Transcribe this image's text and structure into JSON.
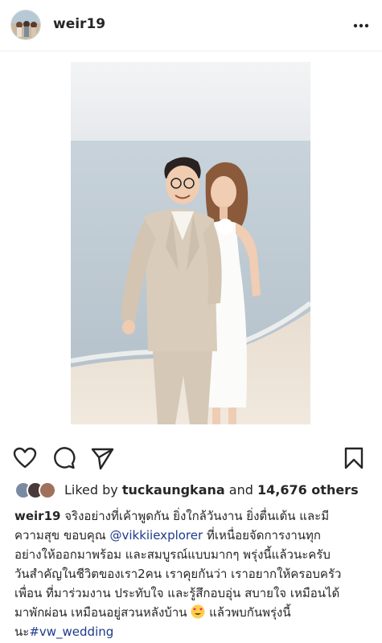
{
  "post": {
    "username": "weir19"
  },
  "likes": {
    "prefix": "Liked by",
    "liker": "tuckaungkana",
    "joiner": "and",
    "count_text": "14,676 others"
  },
  "caption": {
    "username": "weir19",
    "line1": "จริงอย่างที่เค้าพูดกัน ยิ่งใกล้วันงาน ยิ่งตื่นเต้น และมี",
    "line2_pre": "ความสุข ขอบคุณ",
    "mention": "@vikkiiexplorer",
    "line2_post": "ที่เหนื่อยจัดการงานทุก",
    "line3": "อย่างให้ออกมาพร้อม และสมบูรณ์แบบมากๆ พรุ่งนี้แล้วนะครับ",
    "line4": "วันสำคัญในชีวิตของเรา2คน เราคุยกันว่า เราอยากให้ครอบครัว",
    "line5": "เพื่อน ที่มาร่วมงาน ประทับใจ และรู้สึกอบอุ่น สบายใจ เหมือนได้",
    "line6_pre": "มาพักผ่อน เหมือนอยู่สวนหลังบ้าน",
    "line6_post": "แล้วพบกันพรุ่งนี้",
    "line7_pre": "นะ",
    "hashtag": "#vw_wedding"
  },
  "icons": {
    "more": "more-horizontal-icon",
    "like": "heart-icon",
    "comment": "comment-icon",
    "share": "send-icon",
    "save": "bookmark-icon",
    "emoji": "heart-eyes-emoji"
  },
  "colors": {
    "text": "#262626",
    "link": "#1e3a8a",
    "divider": "#efefef"
  }
}
